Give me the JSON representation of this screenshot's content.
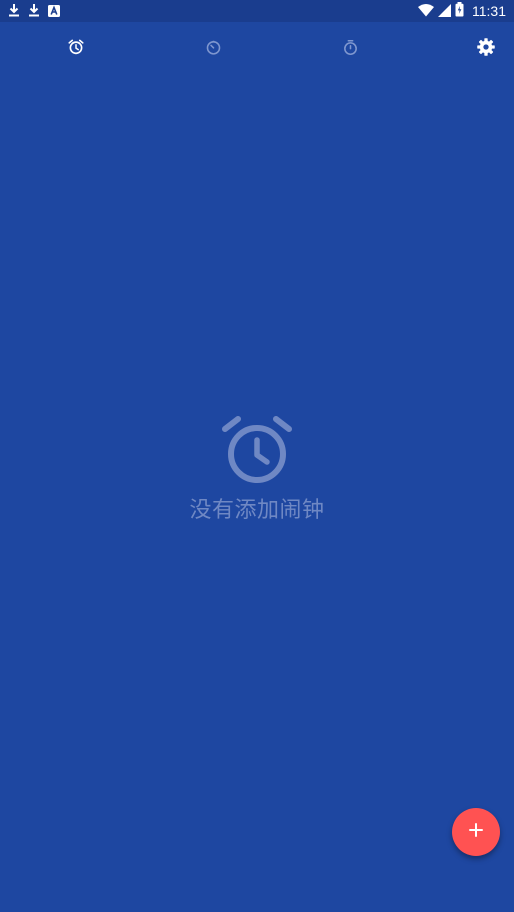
{
  "status_bar": {
    "time": "11:31",
    "left_icons": [
      "download-icon",
      "download-icon",
      "app-a-icon"
    ],
    "right_icons": [
      "wifi-icon",
      "signal-icon",
      "battery-icon"
    ]
  },
  "tabs": [
    {
      "name": "alarm",
      "icon": "alarm-clock-icon",
      "selected": true
    },
    {
      "name": "clock",
      "icon": "clock-icon",
      "selected": false
    },
    {
      "name": "timer",
      "icon": "timer-icon",
      "selected": false
    },
    {
      "name": "stopwatch",
      "icon": "stopwatch-icon",
      "selected": false
    }
  ],
  "settings_icon": "gear-icon",
  "empty_state": {
    "icon": "alarm-clock-icon",
    "message": "没有添加闹钟"
  },
  "fab": {
    "label": "+",
    "icon": "plus-icon"
  },
  "colors": {
    "background": "#1e47a1",
    "status_bar": "#1a3d8e",
    "fab": "#ff5252",
    "empty_text": "#6f88c4",
    "icon_selected": "#ffffff",
    "icon_unselected": "#7f97cf"
  }
}
